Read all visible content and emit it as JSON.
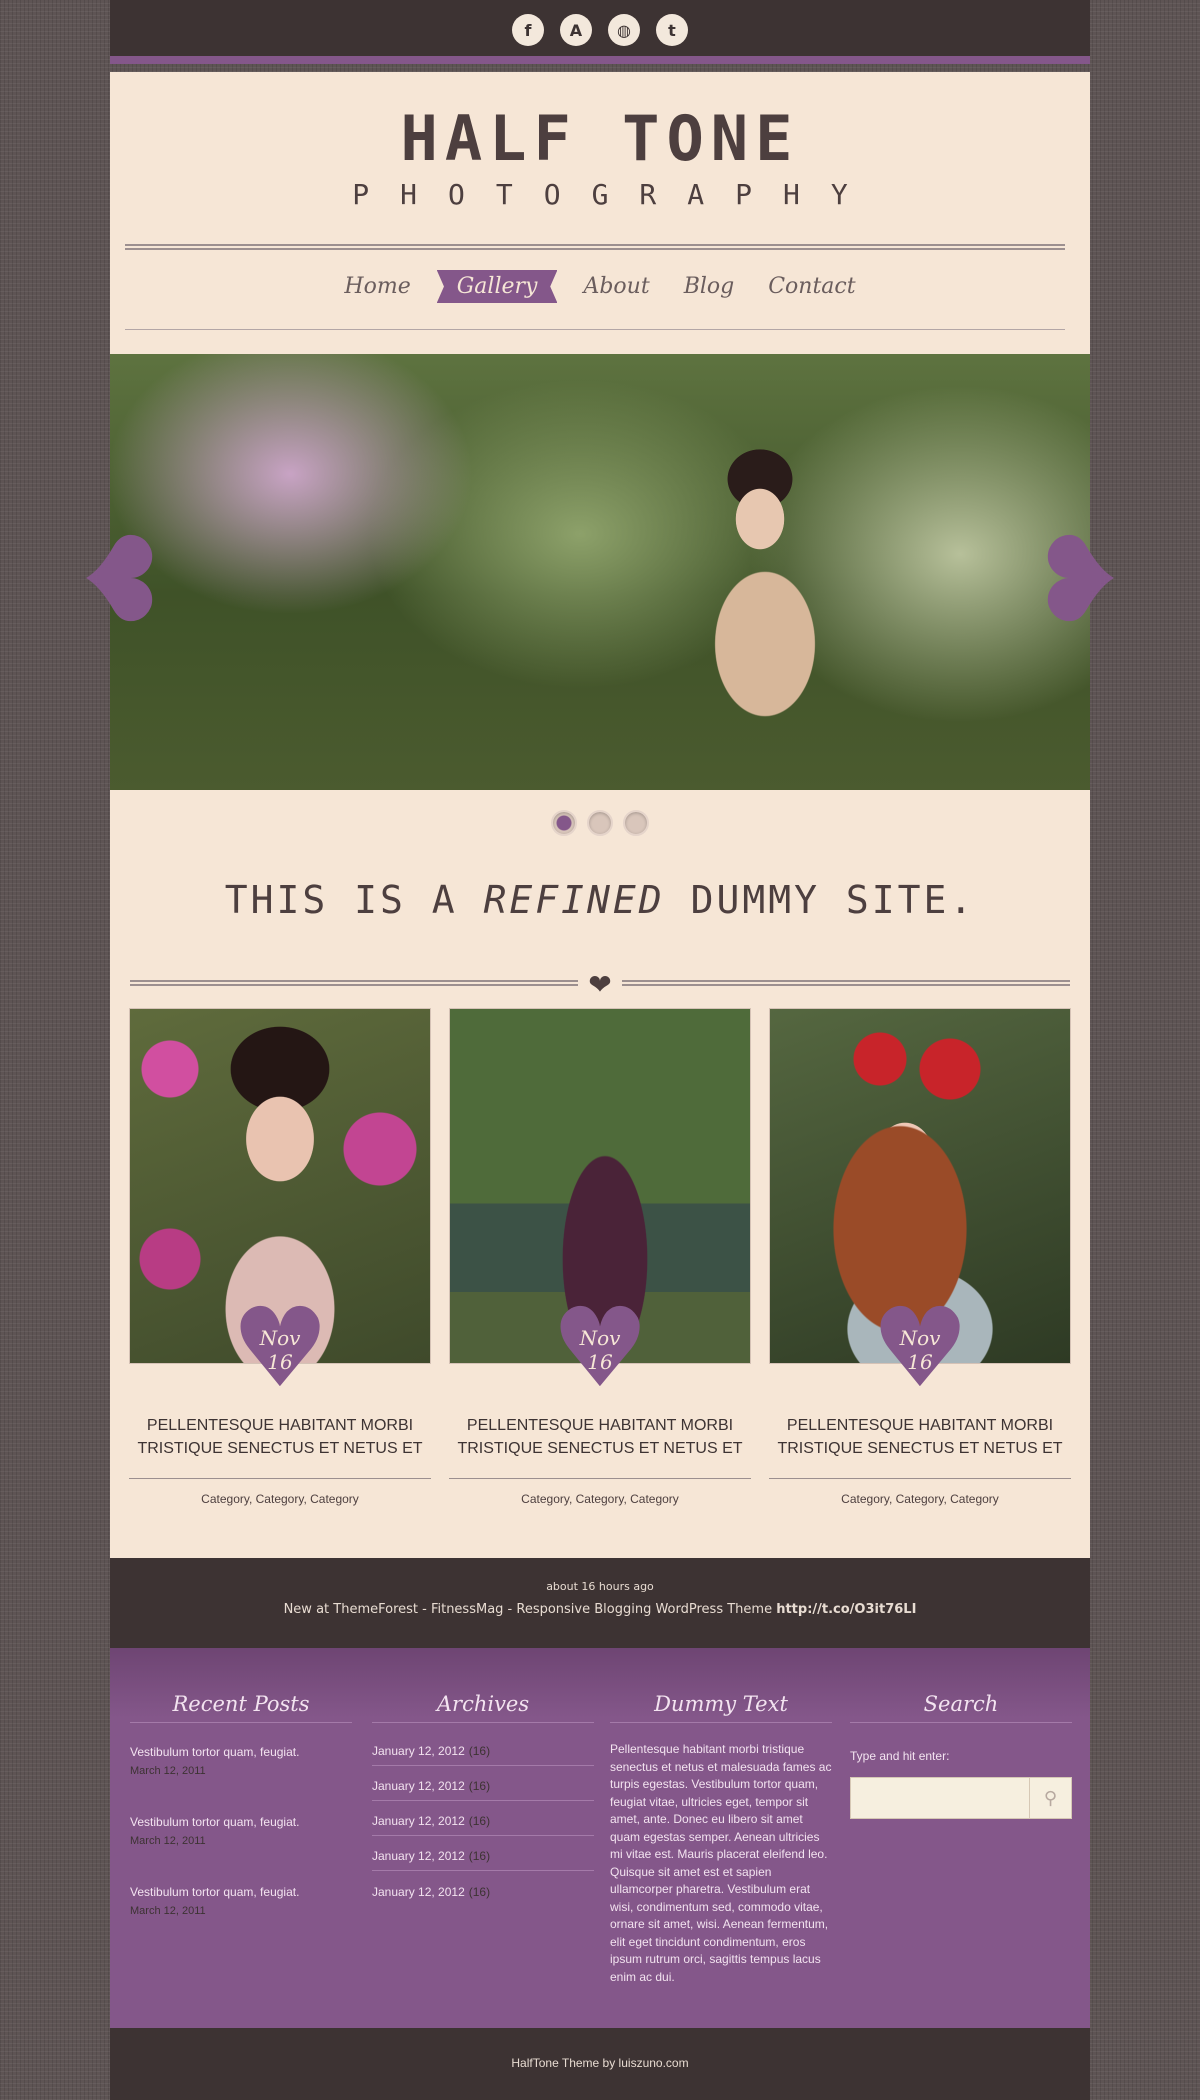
{
  "social": {
    "icons": [
      {
        "name": "facebook",
        "glyph": "f"
      },
      {
        "name": "deviantart",
        "glyph": "A"
      },
      {
        "name": "dribbble",
        "glyph": "◍"
      },
      {
        "name": "twitter",
        "glyph": "t"
      }
    ]
  },
  "header": {
    "title": "HALF TONE",
    "subtitle": "PHOTOGRAPHY",
    "nav": [
      {
        "label": "Home",
        "active": false
      },
      {
        "label": "Gallery",
        "active": true
      },
      {
        "label": "About",
        "active": false
      },
      {
        "label": "Blog",
        "active": false
      },
      {
        "label": "Contact",
        "active": false
      }
    ]
  },
  "slider": {
    "prev_glyph": "❥",
    "next_glyph": "❥",
    "dots": 3,
    "active_dot": 1
  },
  "tagline": {
    "before": "THIS IS A ",
    "emphasis": "REFINED",
    "after": " DUMMY SITE."
  },
  "divider_heart": "❤",
  "posts": [
    {
      "month": "Nov",
      "day": "16",
      "title": "PELLENTESQUE HABITANT MORBI TRISTIQUE SENECTUS ET NETUS ET",
      "categories": "Category, Category, Category"
    },
    {
      "month": "Nov",
      "day": "16",
      "title": "PELLENTESQUE HABITANT MORBI TRISTIQUE SENECTUS ET NETUS ET",
      "categories": "Category, Category, Category"
    },
    {
      "month": "Nov",
      "day": "16",
      "title": "PELLENTESQUE HABITANT MORBI TRISTIQUE SENECTUS ET NETUS ET",
      "categories": "Category, Category, Category"
    }
  ],
  "tweet": {
    "ago": "about 16 hours ago",
    "text": "New at ThemeForest - FitnessMag - Responsive Blogging WordPress Theme ",
    "link": "http://t.co/O3it76LI"
  },
  "footer": {
    "recent_posts": {
      "title": "Recent Posts",
      "items": [
        {
          "title": "Vestibulum tortor quam, feugiat.",
          "date": "March 12, 2011"
        },
        {
          "title": "Vestibulum tortor quam, feugiat.",
          "date": "March 12, 2011"
        },
        {
          "title": "Vestibulum tortor quam, feugiat.",
          "date": "March 12, 2011"
        }
      ]
    },
    "archives": {
      "title": "Archives",
      "items": [
        {
          "label": "January 12, 2012",
          "count": "(16)"
        },
        {
          "label": "January 12, 2012",
          "count": "(16)"
        },
        {
          "label": "January 12, 2012",
          "count": "(16)"
        },
        {
          "label": "January 12, 2012",
          "count": "(16)"
        },
        {
          "label": "January 12, 2012",
          "count": "(16)"
        }
      ]
    },
    "dummy_text": {
      "title": "Dummy Text",
      "body": "Pellentesque habitant morbi tristique senectus et netus et malesuada fames ac turpis egestas. Vestibulum tortor quam, feugiat vitae, ultricies eget, tempor sit amet, ante. Donec eu libero sit amet quam egestas semper. Aenean ultricies mi vitae est. Mauris placerat eleifend leo. Quisque sit amet est et sapien ullamcorper pharetra. Vestibulum erat wisi, condimentum sed, commodo vitae, ornare sit amet, wisi. Aenean fermentum, elit eget tincidunt condimentum, eros ipsum rutrum orci, sagittis tempus lacus enim ac dui."
    },
    "search": {
      "title": "Search",
      "label": "Type and hit enter:",
      "value": "",
      "button_icon": "search-icon"
    }
  },
  "credits": "HalfTone Theme by luiszuno.com",
  "colors": {
    "accent": "#84578a",
    "dark": "#3d3333",
    "cream": "#f6e6d6"
  }
}
